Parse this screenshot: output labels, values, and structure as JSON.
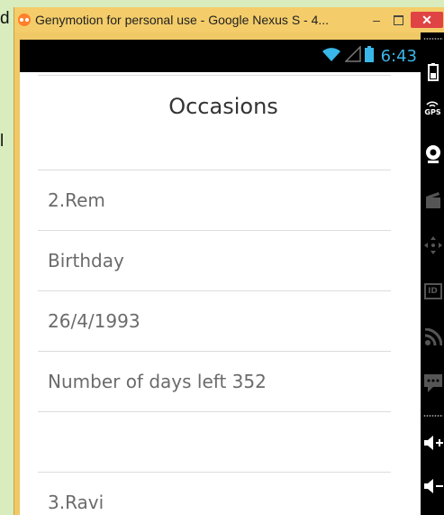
{
  "window": {
    "title": "Genymotion for personal use - Google Nexus S - 4...",
    "minimize_glyph": "–",
    "close_glyph": "✕"
  },
  "background": {
    "fragments": [
      "d",
      "l"
    ]
  },
  "statusbar": {
    "time": "6:43",
    "icons": [
      "wifi-icon",
      "signal-icon",
      "battery-icon"
    ],
    "accent_color": "#39b7e8"
  },
  "screen": {
    "title": "Occasions",
    "items": [
      "2.Rem",
      "Birthday",
      "26/4/1993",
      "Number of days left 352",
      "",
      "3.Ravi"
    ]
  },
  "toolbar": {
    "gps_label": "GPS",
    "id_label": "ID",
    "icons": [
      "battery-icon",
      "gps-icon",
      "camera-icon",
      "capture-icon",
      "dpad-icon",
      "id-icon",
      "rss-icon",
      "sms-icon",
      "volume-up-icon",
      "volume-down-icon"
    ]
  }
}
